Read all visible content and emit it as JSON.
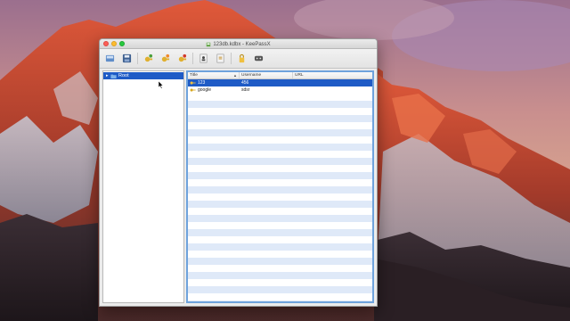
{
  "window": {
    "title": "123db.kdbx - KeePassX"
  },
  "toolbar": {
    "buttons": [
      {
        "name": "open-database-button",
        "icon": "open-database-icon"
      },
      {
        "name": "save-database-button",
        "icon": "save-database-icon"
      },
      {
        "name": "add-entry-button",
        "icon": "add-entry-icon"
      },
      {
        "name": "edit-entry-button",
        "icon": "edit-entry-icon"
      },
      {
        "name": "delete-entry-button",
        "icon": "delete-entry-icon"
      },
      {
        "name": "copy-username-button",
        "icon": "copy-username-icon"
      },
      {
        "name": "copy-password-button",
        "icon": "copy-password-icon"
      },
      {
        "name": "lock-database-button",
        "icon": "lock-icon"
      },
      {
        "name": "password-generator-button",
        "icon": "dice-icon"
      }
    ]
  },
  "groups": {
    "items": [
      {
        "label": "Root",
        "selected": true
      }
    ]
  },
  "entries": {
    "columns": [
      "Title",
      "Username",
      "URL"
    ],
    "rows": [
      {
        "title": "123",
        "username": "456",
        "url": "",
        "selected": true
      },
      {
        "title": "google",
        "username": "sdsr",
        "url": "",
        "selected": false
      }
    ]
  },
  "colors": {
    "selection": "#1f5bc6",
    "alternate_row": "#dfe9f8",
    "table_border": "#6fa3dc"
  }
}
